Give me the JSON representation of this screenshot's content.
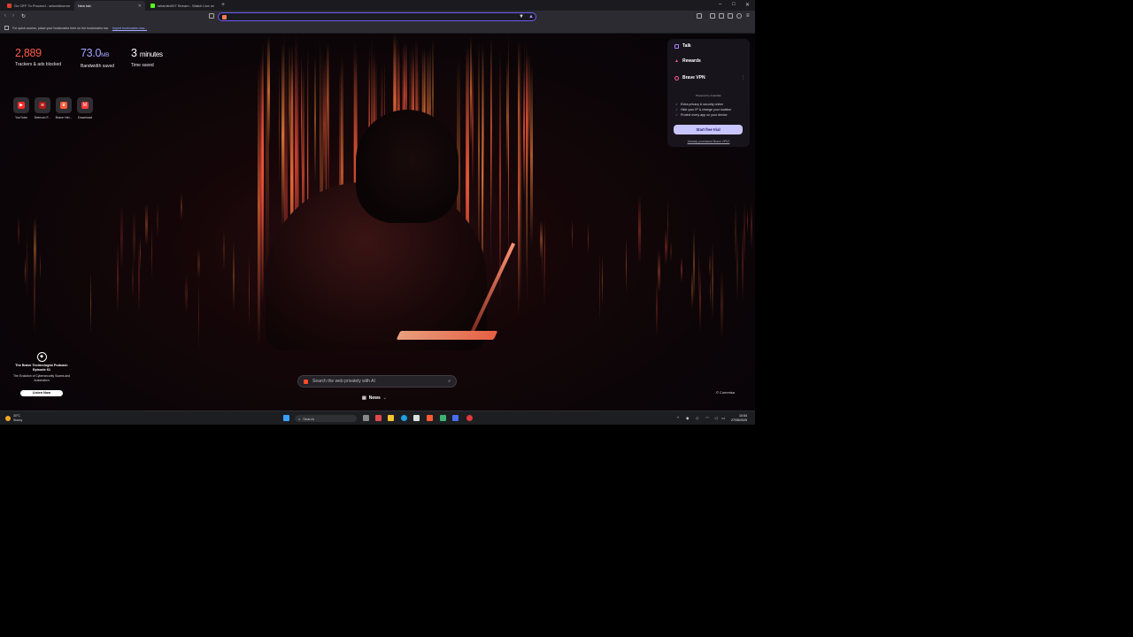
{
  "tabs": [
    {
      "title": "Go OFF To Proceed - selamitnomm",
      "active": false,
      "favicon_color": "#d9412d"
    },
    {
      "title": "New tab",
      "active": true,
      "favicon_color": "#ff5a36"
    },
    {
      "title": "selamitn007 Stream - Watch Live on",
      "active": false,
      "favicon_color": "#53fc18"
    }
  ],
  "window_controls": {
    "minimize": "–",
    "maximize": "□",
    "close": "✕"
  },
  "bookmark_bar": {
    "message": "For quick access, place your bookmarks here on the bookmarks bar.",
    "link": "Import bookmarks now..."
  },
  "stats": {
    "trackers": {
      "value": "2,889",
      "label": "Trackers & ads blocked",
      "color": "#ff5a4a"
    },
    "bandwidth": {
      "value": "73.0",
      "unit": "MB",
      "label": "Bandwidth saved",
      "color": "#a3a8ff"
    },
    "time": {
      "value": "3",
      "unit": "minutes",
      "label": "Time saved",
      "color": "#ffffff"
    }
  },
  "top_sites": [
    {
      "name": "YouTube",
      "icon": "youtube-icon",
      "color": "#ff2a2a",
      "glyph": "▶"
    },
    {
      "name": "Debrum F...",
      "icon": "debrum-icon",
      "color": "#b01818",
      "glyph": "≋"
    },
    {
      "name": "Brave Hel...",
      "icon": "brave-lion-icon",
      "color": "#ff5a36",
      "glyph": "♛"
    },
    {
      "name": "Download",
      "icon": "download-icon",
      "color": "#ff3b3b",
      "glyph": "M"
    }
  ],
  "widget": {
    "talk": "Talk",
    "rewards": "Rewards",
    "vpn": {
      "title": "Brave VPN",
      "powered_by": "Powered by Guardian",
      "features": [
        "Extra privacy & security online",
        "Hide your IP & change your location",
        "Protect every app on your device"
      ],
      "trial_button": "Start free trial",
      "already": "Already purchased Brave VPN?"
    }
  },
  "podcast": {
    "title": "The Brave Technologist Podcast: Episode 61",
    "description": "The Evolution of Cybersecurity Scams and Automation",
    "button": "Listen Now"
  },
  "search": {
    "placeholder": "Search the web privately with AI"
  },
  "news": {
    "label": "News"
  },
  "credit": {
    "text": "© Commisa"
  },
  "taskbar": {
    "weather_temp": "30°C",
    "weather_desc": "Sunny",
    "search_label": "Search",
    "time": "10:54",
    "date": "27/08/2025"
  }
}
